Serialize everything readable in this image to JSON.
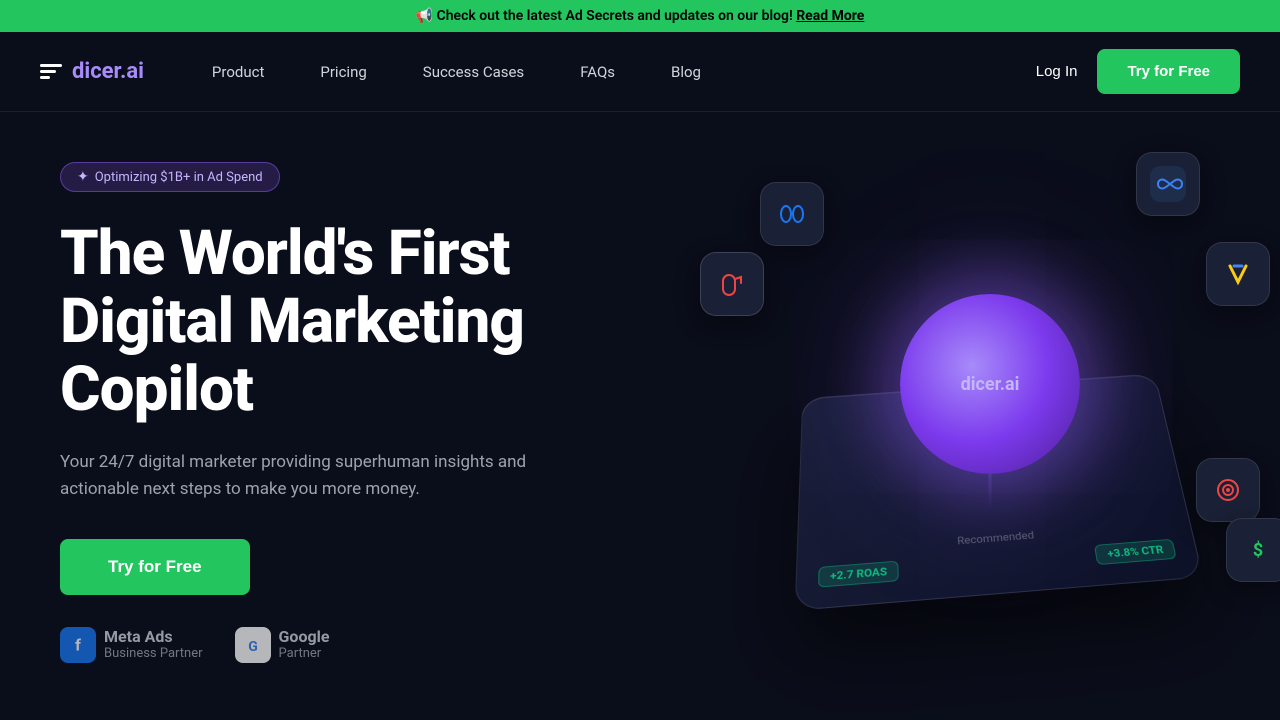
{
  "announcement": {
    "text": "📢 Check out the latest Ad Secrets and updates on our blog!",
    "link_text": "Read More",
    "icon": "📢"
  },
  "nav": {
    "logo_text": "dicer",
    "logo_accent": ".ai",
    "links": [
      {
        "label": "Product",
        "id": "product"
      },
      {
        "label": "Pricing",
        "id": "pricing"
      },
      {
        "label": "Success Cases",
        "id": "success-cases"
      },
      {
        "label": "FAQs",
        "id": "faqs"
      },
      {
        "label": "Blog",
        "id": "blog"
      }
    ],
    "login_label": "Log In",
    "cta_label": "Try for Free"
  },
  "hero": {
    "badge_text": "✦ Optimizing $1B+ in Ad Spend",
    "title_line1": "The World's First",
    "title_line2": "Digital Marketing",
    "title_line3": "Copilot",
    "subtitle": "Your 24/7 digital marketer providing superhuman insights and actionable next steps to make you more money.",
    "cta_label": "Try for Free",
    "center_orb_text": "dicer",
    "center_orb_accent": ".ai"
  },
  "partners": [
    {
      "name": "Meta Ads",
      "subtitle": "Business Partner",
      "icon": "meta"
    },
    {
      "name": "Google",
      "subtitle": "Partner",
      "icon": "google"
    }
  ],
  "stats": [
    {
      "label": "+2.7 ROAS",
      "id": "roas"
    },
    {
      "label": "+3.8% CTR",
      "id": "ctr"
    }
  ],
  "icons": [
    {
      "name": "meta-ads-icon",
      "symbol": "∞",
      "color": "#1877f2"
    },
    {
      "name": "infinity-icon",
      "symbol": "∞",
      "color": "#3b82f6"
    },
    {
      "name": "google-ads-icon",
      "symbol": "▶",
      "color": "#facc15"
    },
    {
      "name": "tiktok-icon",
      "symbol": "🎵",
      "color": "#ff0050"
    },
    {
      "name": "target-icon",
      "symbol": "⊙",
      "color": "#ef4444"
    },
    {
      "name": "dollar-icon",
      "symbol": "$",
      "color": "#22c55e"
    }
  ]
}
